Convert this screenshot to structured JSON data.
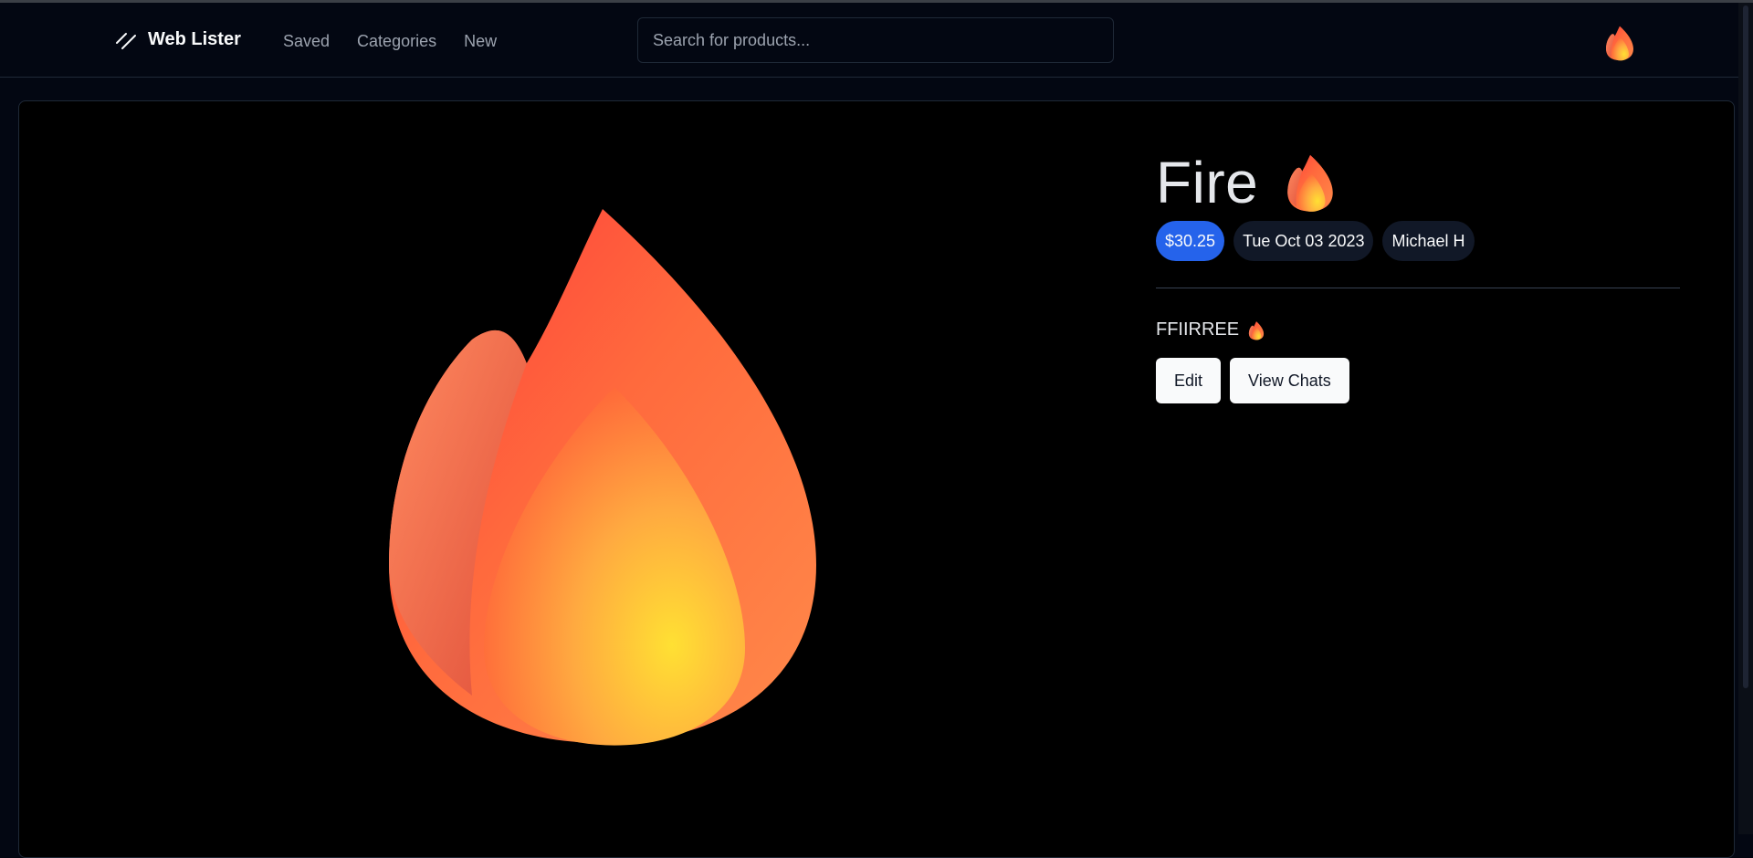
{
  "navbar": {
    "brand": "Web Lister",
    "links": [
      {
        "label": "Saved"
      },
      {
        "label": "Categories"
      },
      {
        "label": "New"
      }
    ],
    "search_placeholder": "Search for products...",
    "avatar_icon": "fire-icon"
  },
  "product": {
    "title": "Fire",
    "title_icon": "fire-icon",
    "price": "$30.25",
    "date": "Tue Oct 03 2023",
    "seller": "Michael H",
    "description": "FFIIRREE",
    "description_icon": "fire-icon",
    "image_icon": "fire-icon"
  },
  "actions": {
    "edit_label": "Edit",
    "view_chats_label": "View Chats"
  },
  "colors": {
    "background": "#030712",
    "card": "#000000",
    "price_badge": "#2563eb",
    "badge": "#111827",
    "button": "#f9fafb"
  }
}
